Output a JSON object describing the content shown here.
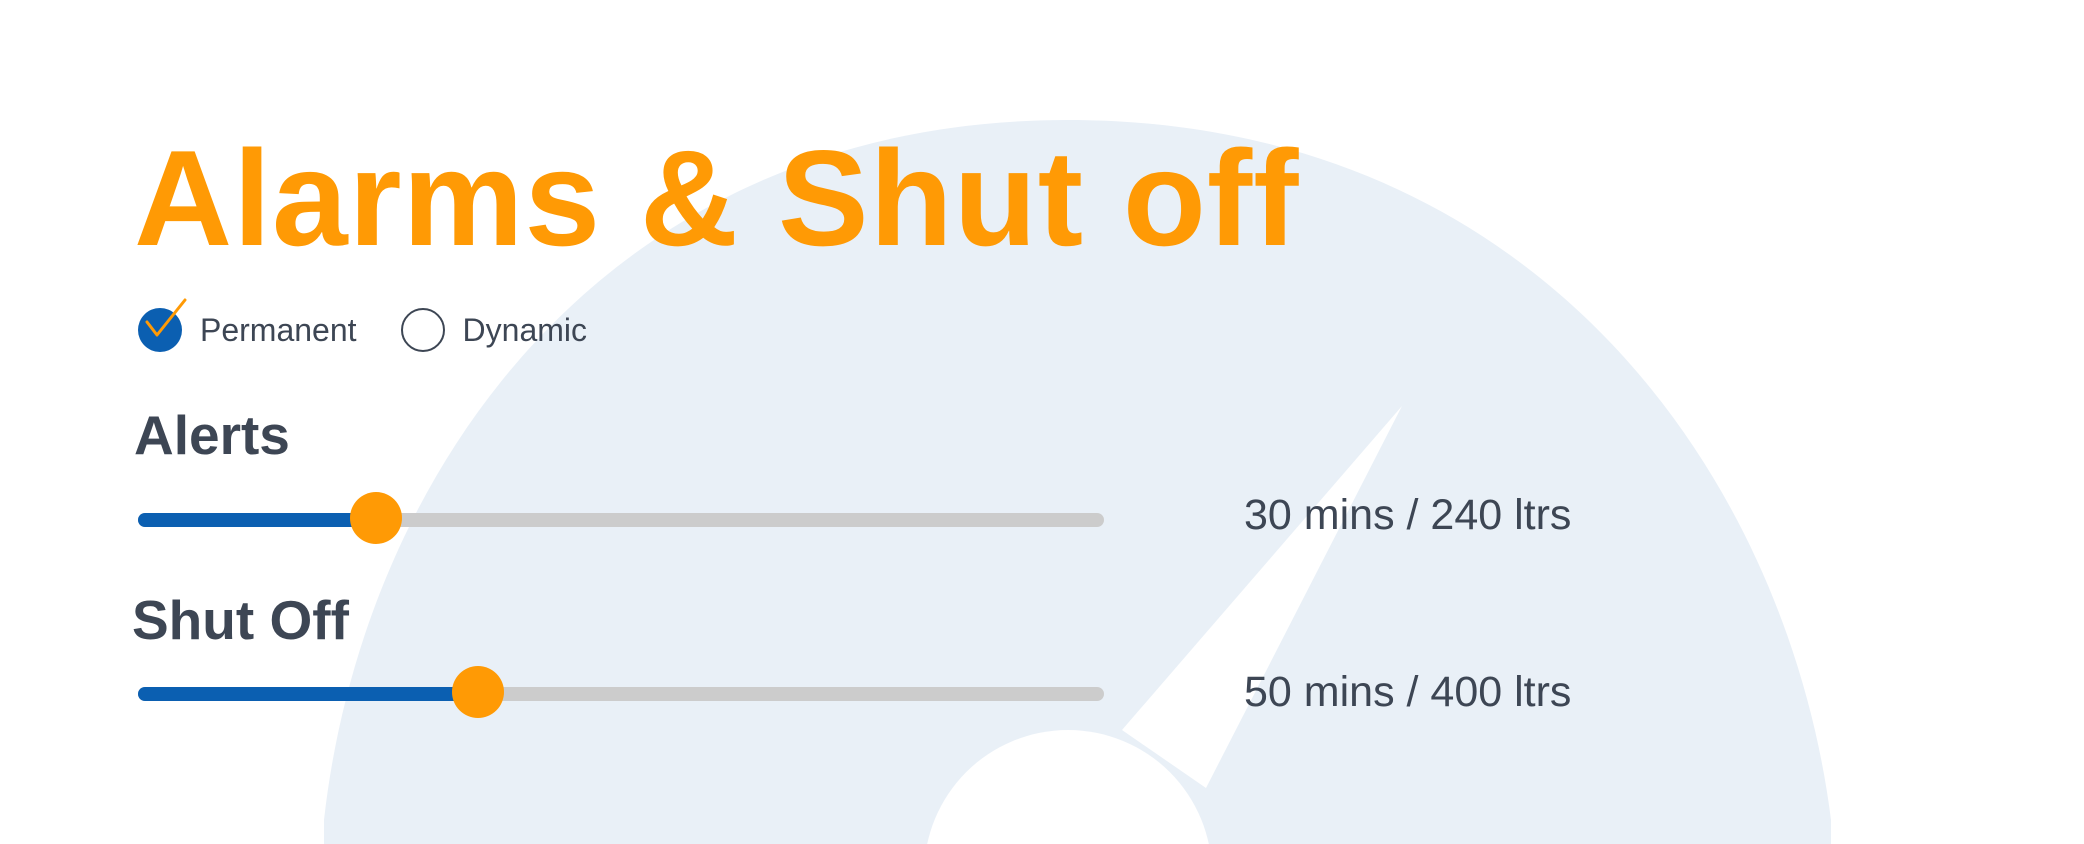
{
  "page": {
    "title": "Alarms & Shut off"
  },
  "mode": {
    "options": [
      {
        "label": "Permanent",
        "selected": true
      },
      {
        "label": "Dynamic",
        "selected": false
      }
    ]
  },
  "alerts": {
    "heading": "Alerts",
    "value_text": "30 mins / 240 ltrs",
    "level_percent": 24.6
  },
  "shutoff": {
    "heading": "Shut Off",
    "value_text": "50 mins / 400 ltrs",
    "level_percent": 35.2
  },
  "colors": {
    "accent": "#ff9a05",
    "primary": "#0b5fb1",
    "text": "#3d4654",
    "track": "#cccccc",
    "gauge_background": "#e9f0f7"
  },
  "icons": {
    "selected_radio": "checkmark-icon",
    "background": "gauge-icon"
  }
}
